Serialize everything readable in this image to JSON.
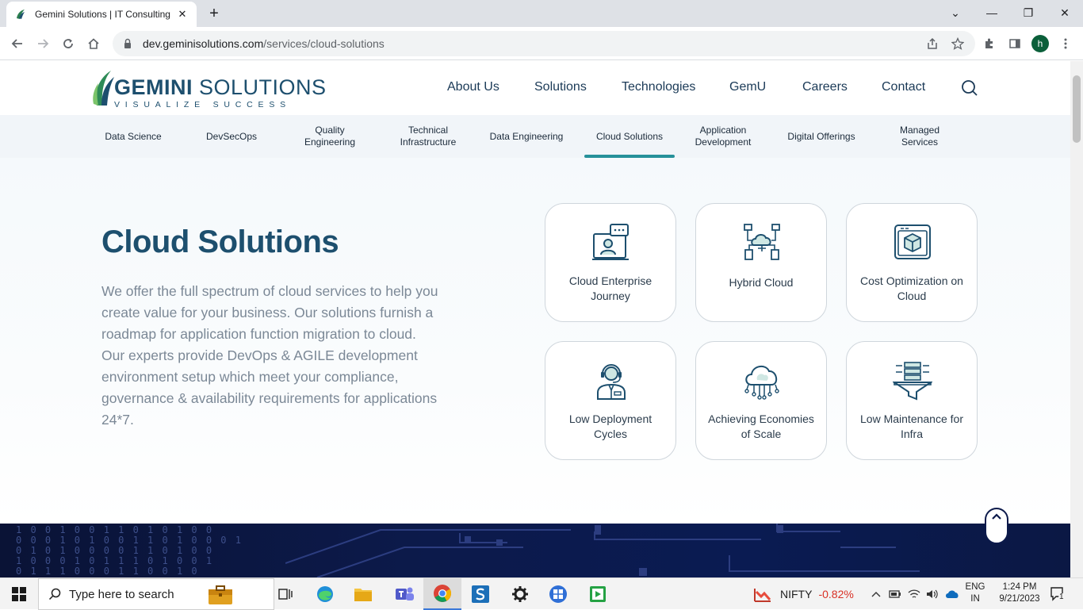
{
  "browser": {
    "tab_title": "Gemini Solutions | IT Consulting",
    "url_host": "dev.geminisolutions.com",
    "url_path": "/services/cloud-solutions",
    "profile_initial": "h"
  },
  "site": {
    "logo_main_bold": "GEMINI",
    "logo_main_light": " SOLUTIONS",
    "logo_tagline": "VISUALIZE SUCCESS",
    "nav": [
      "About Us",
      "Solutions",
      "Technologies",
      "GemU",
      "Careers",
      "Contact"
    ],
    "subnav": [
      [
        "Data Science"
      ],
      [
        "DevSecOps"
      ],
      [
        "Quality",
        "Engineering"
      ],
      [
        "Technical",
        "Infrastructure"
      ],
      [
        "Data Engineering"
      ],
      [
        "Cloud Solutions"
      ],
      [
        "Application",
        "Development"
      ],
      [
        "Digital Offerings"
      ],
      [
        "Managed",
        "Services"
      ]
    ],
    "subnav_active_index": 5
  },
  "hero": {
    "title": "Cloud Solutions",
    "description": "We offer the full spectrum of cloud services to help you create value for your business. Our solutions furnish a roadmap for application function migration to cloud. Our experts provide DevOps & AGILE development environment setup which meet your compliance, governance & availability requirements for applications 24*7."
  },
  "cards": [
    {
      "label": "Cloud Enterprise Journey",
      "icon": "video-call-icon"
    },
    {
      "label": "Hybrid Cloud",
      "icon": "hybrid-cloud-icon"
    },
    {
      "label": "Cost Optimization on Cloud",
      "icon": "cube-monitor-icon"
    },
    {
      "label": "Low Deployment Cycles",
      "icon": "support-agent-icon"
    },
    {
      "label": "Achieving Economies of Scale",
      "icon": "cloud-network-icon"
    },
    {
      "label": "Low Maintenance for Infra",
      "icon": "server-funnel-icon"
    }
  ],
  "banner": {
    "digits": [
      "1 0 0 1 0 0 1 1 0 1 0 1 0 0",
      "0 0 0 1 0 1 0 0 1 1 0 1 0 0 0 1",
      "0 1 0 1 0 0 0 0 1 1 0 1 0 0",
      "1 0 0 0 1 0 1 1 1 0 1 0 0 1",
      "0 1 1 1 0 0 0 1 1 0 0 1 0"
    ]
  },
  "taskbar": {
    "search_placeholder": "Type here to search",
    "ticker_name": "NIFTY",
    "ticker_change": "-0.82%",
    "lang_top": "ENG",
    "lang_bottom": "IN",
    "time": "1:24 PM",
    "date": "9/21/2023",
    "notification_count": "1"
  }
}
